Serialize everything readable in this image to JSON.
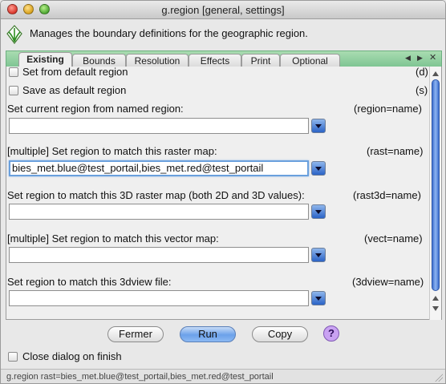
{
  "window": {
    "title": "g.region [general, settings]"
  },
  "header": {
    "description": "Manages the boundary definitions for the geographic region."
  },
  "tabs": [
    {
      "label": "Existing",
      "active": true
    },
    {
      "label": "Bounds"
    },
    {
      "label": "Resolution"
    },
    {
      "label": "Effects"
    },
    {
      "label": "Print"
    },
    {
      "label": "Optional"
    }
  ],
  "options": {
    "default_region": {
      "label": "Set from default region",
      "flag": "(d)",
      "checked": false
    },
    "save_default": {
      "label": "Save as default region",
      "flag": "(s)",
      "checked": false
    },
    "region": {
      "label": "Set current region from named region:",
      "param": "(region=name)",
      "value": ""
    },
    "rast": {
      "label": "[multiple] Set region to match this raster map:",
      "param": "(rast=name)",
      "value": "bies_met.blue@test_portail,bies_met.red@test_portail"
    },
    "rast3d": {
      "label": "Set region to match this 3D raster map (both 2D and 3D values):",
      "param": "(rast3d=name)",
      "value": ""
    },
    "vect": {
      "label": "[multiple] Set region to match this vector map:",
      "param": "(vect=name)",
      "value": ""
    },
    "view3d": {
      "label": "Set region to match this 3dview file:",
      "param": "(3dview=name)",
      "value": ""
    }
  },
  "buttons": {
    "close": "Fermer",
    "run": "Run",
    "copy": "Copy",
    "help": "?"
  },
  "close_on_finish": {
    "label": "Close dialog on finish",
    "checked": false
  },
  "status": "g.region rast=bies_met.blue@test_portail,bies_met.red@test_portail",
  "colors": {
    "tab_bar": "#7fc593",
    "accent": "#2b63c6",
    "help": "#c9a2f2"
  }
}
